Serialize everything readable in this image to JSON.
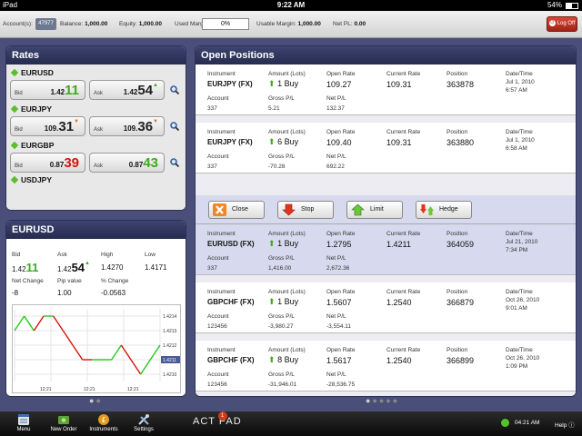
{
  "status": {
    "device": "iPad",
    "time": "9:22 AM",
    "battery": "54%",
    "battery_level": 0.54
  },
  "account_bar": {
    "account_label": "Account(s):",
    "account_id": "47977",
    "balance_label": "Balance:",
    "balance": "1,000.00",
    "equity_label": "Equity:",
    "equity": "1,000.00",
    "used_margin_label": "Used Margin:",
    "used_margin": "0%",
    "usable_margin_label": "Usable Margin:",
    "usable_margin": "1,000.00",
    "net_pl_label": "Net PL:",
    "net_pl": "0.00",
    "logoff_label": "Log Off"
  },
  "rates": {
    "title": "Rates",
    "bid_label": "Bid",
    "ask_label": "Ask",
    "pairs": [
      {
        "name": "EURUSD",
        "bid_small": "1.42",
        "bid_big": "11",
        "bid_color": "green",
        "bid_dir": "",
        "ask_small": "1.42",
        "ask_big": "54",
        "ask_color": "black",
        "ask_dir": "up"
      },
      {
        "name": "EURJPY",
        "bid_small": "109.",
        "bid_big": "31",
        "bid_color": "black",
        "bid_dir": "down",
        "ask_small": "109.",
        "ask_big": "36",
        "ask_color": "black",
        "ask_dir": "down"
      },
      {
        "name": "EURGBP",
        "bid_small": "0.87",
        "bid_big": "39",
        "bid_color": "red",
        "bid_dir": "",
        "ask_small": "0.87",
        "ask_big": "43",
        "ask_color": "green",
        "ask_dir": ""
      },
      {
        "name": "USDJPY"
      }
    ]
  },
  "detail": {
    "title": "EURUSD",
    "bid_label": "Bid",
    "bid_small": "1.42",
    "bid_big": "11",
    "ask_label": "Ask",
    "ask_small": "1.42",
    "ask_big": "54",
    "high_label": "High",
    "high": "1.4270",
    "low_label": "Low",
    "low": "1.4171",
    "net_change_label": "Net Change",
    "net_change": "-8",
    "pip_value_label": "Pip value",
    "pip_value": "1.00",
    "pct_change_label": "% Change",
    "pct_change": "-0.0563"
  },
  "chart_data": {
    "type": "line",
    "x_ticks": [
      "12:21",
      "12:21",
      "12:21"
    ],
    "y_ticks": [
      "1.4214",
      "1.4213",
      "1.4212",
      "1.4211",
      "1.4210"
    ],
    "ylim": [
      1.42095,
      1.42145
    ],
    "current": "1.4211",
    "points": [
      1.4213,
      1.4214,
      1.4213,
      1.4214,
      1.4214,
      1.4213,
      1.4212,
      1.4211,
      1.4211,
      1.4211,
      1.4211,
      1.4212,
      1.4211,
      1.421,
      1.4211,
      1.4212
    ],
    "colors": [
      "green",
      "green",
      "red",
      "green",
      "red",
      "red",
      "red",
      "red",
      "green",
      "green",
      "green",
      "red",
      "red",
      "green",
      "green"
    ]
  },
  "positions": {
    "title": "Open Positions",
    "labels": {
      "instrument": "Instrument",
      "amount": "Amount (Lots)",
      "open_rate": "Open Rate",
      "current_rate": "Current Rate",
      "position": "Position",
      "datetime": "Date/Time",
      "account": "Account",
      "gross": "Gross P/L",
      "net": "Net P/L"
    },
    "rows": [
      {
        "instrument": "EURJPY (FX)",
        "amount": "1 Buy",
        "open_rate": "109.27",
        "current_rate": "109.31",
        "position": "363878",
        "date": "Jul 1, 2010",
        "time": "6:57 AM",
        "account": "337",
        "gross": "5.21",
        "net": "132.37",
        "net_color": "green"
      },
      {
        "instrument": "EURJPY (FX)",
        "amount": "6 Buy",
        "open_rate": "109.40",
        "current_rate": "109.31",
        "position": "363880",
        "date": "Jul 1, 2010",
        "time": "6:58 AM",
        "account": "337",
        "gross": "-70.28",
        "net": "692.22",
        "net_color": "green"
      },
      {
        "instrument": "EURUSD (FX)",
        "amount": "1 Buy",
        "open_rate": "1.2795",
        "current_rate": "1.4211",
        "position": "364059",
        "date": "Jul 21, 2010",
        "time": "7:34 PM",
        "account": "337",
        "gross": "1,416.00",
        "net": "2,672.36",
        "net_color": "green"
      },
      {
        "instrument": "GBPCHF (FX)",
        "amount": "1 Buy",
        "open_rate": "1.5607",
        "current_rate": "1.2540",
        "position": "366879",
        "date": "Oct 26, 2010",
        "time": "9:01 AM",
        "account": "123456",
        "gross": "-3,980.27",
        "net": "-3,554.11",
        "net_color": "red"
      },
      {
        "instrument": "GBPCHF (FX)",
        "amount": "8 Buy",
        "open_rate": "1.5617",
        "current_rate": "1.2540",
        "position": "366899",
        "date": "Oct 26, 2010",
        "time": "1:09 PM",
        "account": "123456",
        "gross": "-31,946.01",
        "net": "-28,536.75",
        "net_color": "red"
      }
    ],
    "actions": {
      "close": "Close",
      "stop": "Stop",
      "limit": "Limit",
      "hedge": "Hedge"
    }
  },
  "tabbar": {
    "menu": "Menu",
    "new_order": "New Order",
    "instruments": "Instruments",
    "settings": "Settings",
    "brand": "ACT PAD",
    "badge": "1",
    "clock": "04:21 AM",
    "help": "Help"
  }
}
